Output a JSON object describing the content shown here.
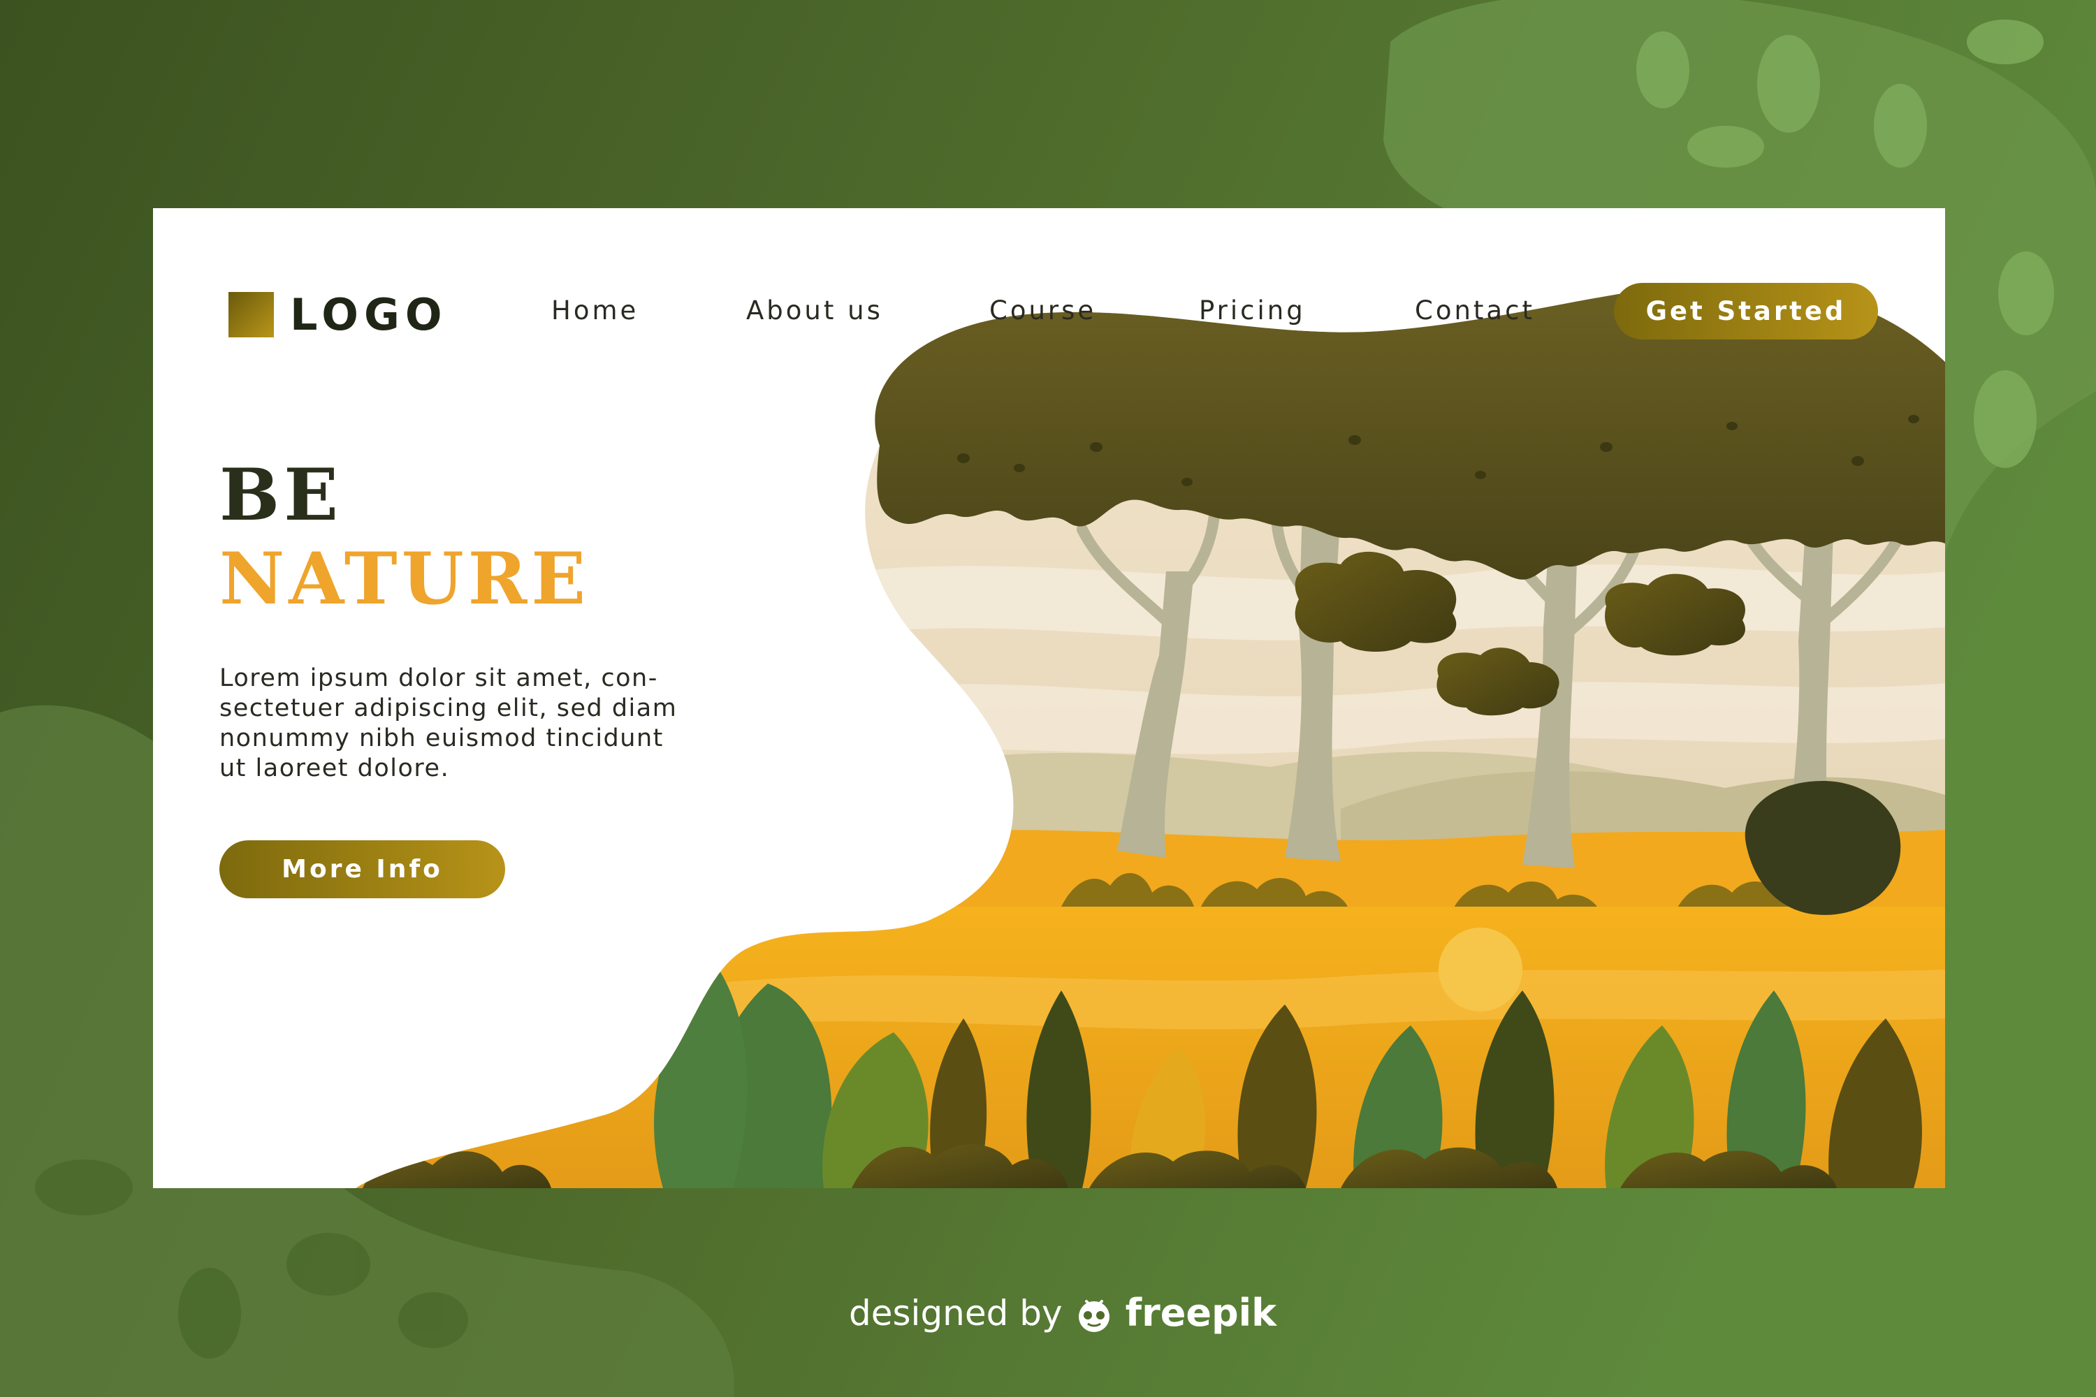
{
  "brand": {
    "logo_text": "LOGO"
  },
  "nav": {
    "items": [
      {
        "label": "Home"
      },
      {
        "label": "About us"
      },
      {
        "label": "Course"
      },
      {
        "label": "Pricing"
      },
      {
        "label": "Contact"
      }
    ],
    "cta_label": "Get Started"
  },
  "hero": {
    "title_line1": "BE",
    "title_line2": "NATURE",
    "description_lines": [
      "Lorem ipsum dolor sit amet, con-",
      "sectetuer adipiscing elit, sed diam",
      "nonummy nibh euismod tincidunt",
      "ut laoreet dolore."
    ],
    "button_label": "More Info"
  },
  "footer": {
    "credit_text": "designed by",
    "credit_brand": "freepik"
  },
  "colors": {
    "background_green": "#4e6a2c",
    "accent_gold": "#b8951a",
    "title_orange": "#efa42c",
    "canopy_olive": "#5a5220"
  }
}
